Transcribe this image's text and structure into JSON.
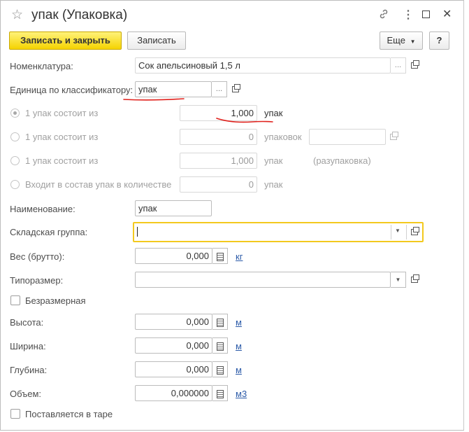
{
  "window": {
    "title": "упак (Упаковка)",
    "icons": [
      "star-icon",
      "link-icon",
      "more-vertical-icon",
      "maximize-icon",
      "close-icon"
    ]
  },
  "toolbar": {
    "save_close_label": "Записать и закрыть",
    "save_label": "Записать",
    "more_label": "Еще",
    "help_label": "?"
  },
  "form": {
    "nomenclature": {
      "label": "Номенклатура:",
      "value": "Сок апельсиновый 1,5 л",
      "select": "..."
    },
    "unit_classifier": {
      "label": "Единица по классификатору:",
      "value": "упак",
      "select": "..."
    },
    "options": [
      {
        "label": "1 упак состоит из",
        "value": "1,000",
        "unit": "упак",
        "selected": true
      },
      {
        "label": "1 упак состоит из",
        "value": "0",
        "unit": "упаковок",
        "selected": false
      },
      {
        "label": "1 упак состоит из",
        "value": "1,000",
        "unit": "упак",
        "note": "(разупаковка)",
        "selected": false
      },
      {
        "label": "Входит в состав упак в количестве",
        "value": "0",
        "unit": "упак",
        "selected": false
      }
    ],
    "name": {
      "label": "Наименование:",
      "value": "упак"
    },
    "warehouse_group": {
      "label": "Складская группа:",
      "value": ""
    },
    "weight": {
      "label": "Вес (брутто):",
      "value": "0,000",
      "unit": "кг"
    },
    "size_type": {
      "label": "Типоразмер:",
      "value": ""
    },
    "sizeless": {
      "label": "Безразмерная",
      "checked": false
    },
    "height": {
      "label": "Высота:",
      "value": "0,000",
      "unit": "м"
    },
    "width": {
      "label": "Ширина:",
      "value": "0,000",
      "unit": "м"
    },
    "depth": {
      "label": "Глубина:",
      "value": "0,000",
      "unit": "м"
    },
    "volume": {
      "label": "Объем:",
      "value": "0,000000",
      "unit": "м3"
    },
    "tare": {
      "label": "Поставляется в таре",
      "checked": false
    }
  },
  "colors": {
    "primary_button": "#f5d300",
    "focus_border": "#f3c91e",
    "annotation": "#e0201b",
    "link": "#2b5aa8"
  }
}
